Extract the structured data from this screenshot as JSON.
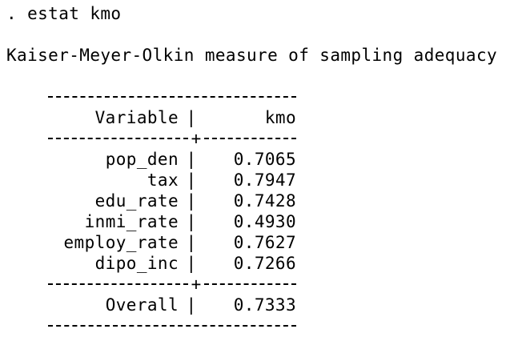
{
  "command": ". estat kmo",
  "title": "Kaiser-Meyer-Olkin measure of sampling adequacy",
  "table": {
    "header": {
      "variable": "Variable",
      "value": "kmo"
    },
    "separator": "|",
    "rows": [
      {
        "variable": "pop_den",
        "value": "0.7065"
      },
      {
        "variable": "tax",
        "value": "0.7947"
      },
      {
        "variable": "edu_rate",
        "value": "0.7428"
      },
      {
        "variable": "inmi_rate",
        "value": "0.4930"
      },
      {
        "variable": "employ_rate",
        "value": "0.7627"
      },
      {
        "variable": "dipo_inc",
        "value": "0.7266"
      }
    ],
    "overall": {
      "variable": "Overall",
      "value": "0.7333"
    },
    "cross": "+"
  }
}
